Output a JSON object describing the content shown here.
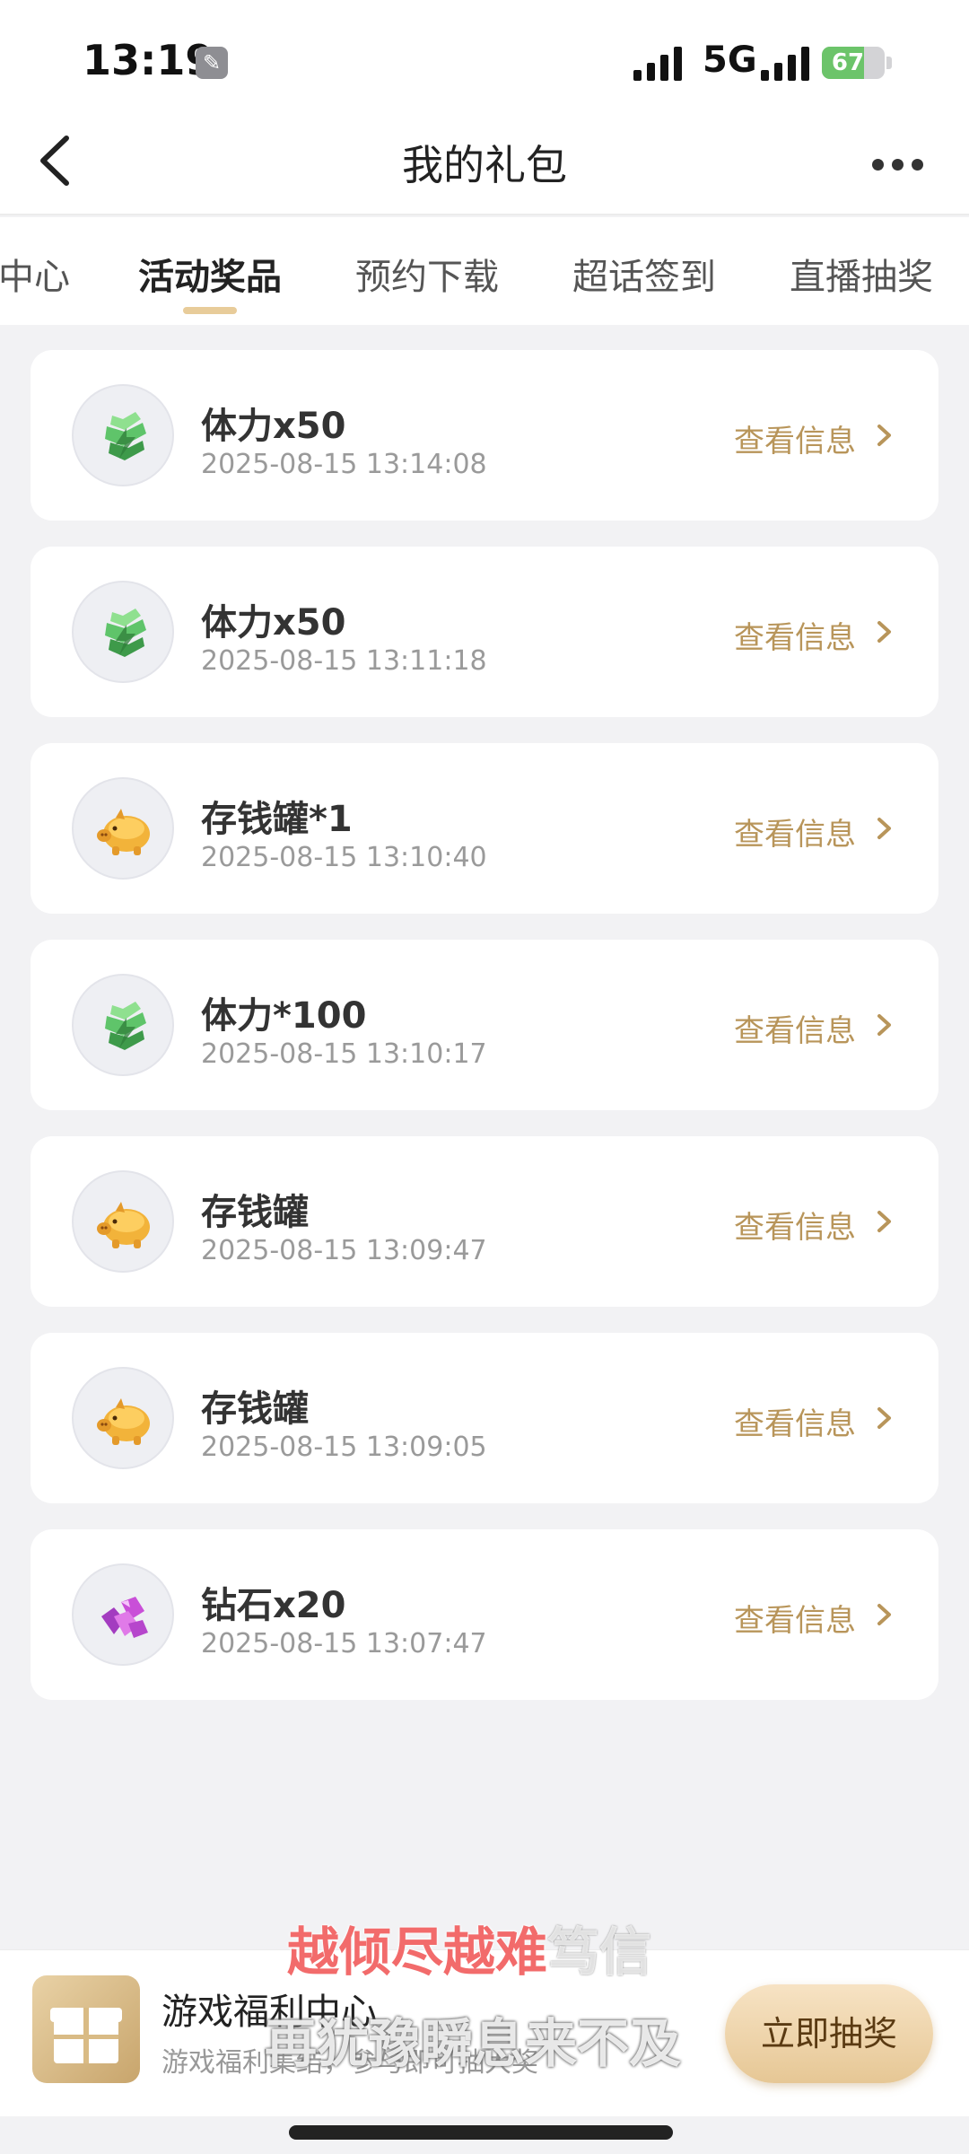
{
  "status_bar": {
    "time": "13:19",
    "network": "5G",
    "battery": "67",
    "battery_level": 0.67
  },
  "nav": {
    "title": "我的礼包"
  },
  "tabs": [
    {
      "label": "中心"
    },
    {
      "label": "活动奖品",
      "active": true
    },
    {
      "label": "预约下载"
    },
    {
      "label": "超话签到"
    },
    {
      "label": "直播抽奖"
    }
  ],
  "gifts": [
    {
      "title": "体力x50",
      "time": "2025-08-15 13:14:08",
      "link": "查看信息",
      "icon": "stamina-icon"
    },
    {
      "title": "体力x50",
      "time": "2025-08-15 13:11:18",
      "link": "查看信息",
      "icon": "stamina-icon"
    },
    {
      "title": "存钱罐*1",
      "time": "2025-08-15 13:10:40",
      "link": "查看信息",
      "icon": "piggy-bank-icon"
    },
    {
      "title": "体力*100",
      "time": "2025-08-15 13:10:17",
      "link": "查看信息",
      "icon": "stamina-icon"
    },
    {
      "title": "存钱罐",
      "time": "2025-08-15 13:09:47",
      "link": "查看信息",
      "icon": "piggy-bank-icon"
    },
    {
      "title": "存钱罐",
      "time": "2025-08-15 13:09:05",
      "link": "查看信息",
      "icon": "piggy-bank-icon"
    },
    {
      "title": "钻石x20",
      "time": "2025-08-15 13:07:47",
      "link": "查看信息",
      "icon": "diamond-icon"
    }
  ],
  "banner": {
    "title": "游戏福利中心",
    "subtitle": "游戏福利集结，参与即可抽大奖",
    "button": "立即抽奖"
  },
  "caption": {
    "line1_highlight": "越倾尽越难",
    "line1_rest": "笃信",
    "line2": "再犹豫瞬息来不及"
  },
  "colors": {
    "accent_gold": "#b8955a",
    "stamina_green": "#5fc46a",
    "piggy_orange": "#f2b33a",
    "diamond_purple": "#c94fd8"
  }
}
